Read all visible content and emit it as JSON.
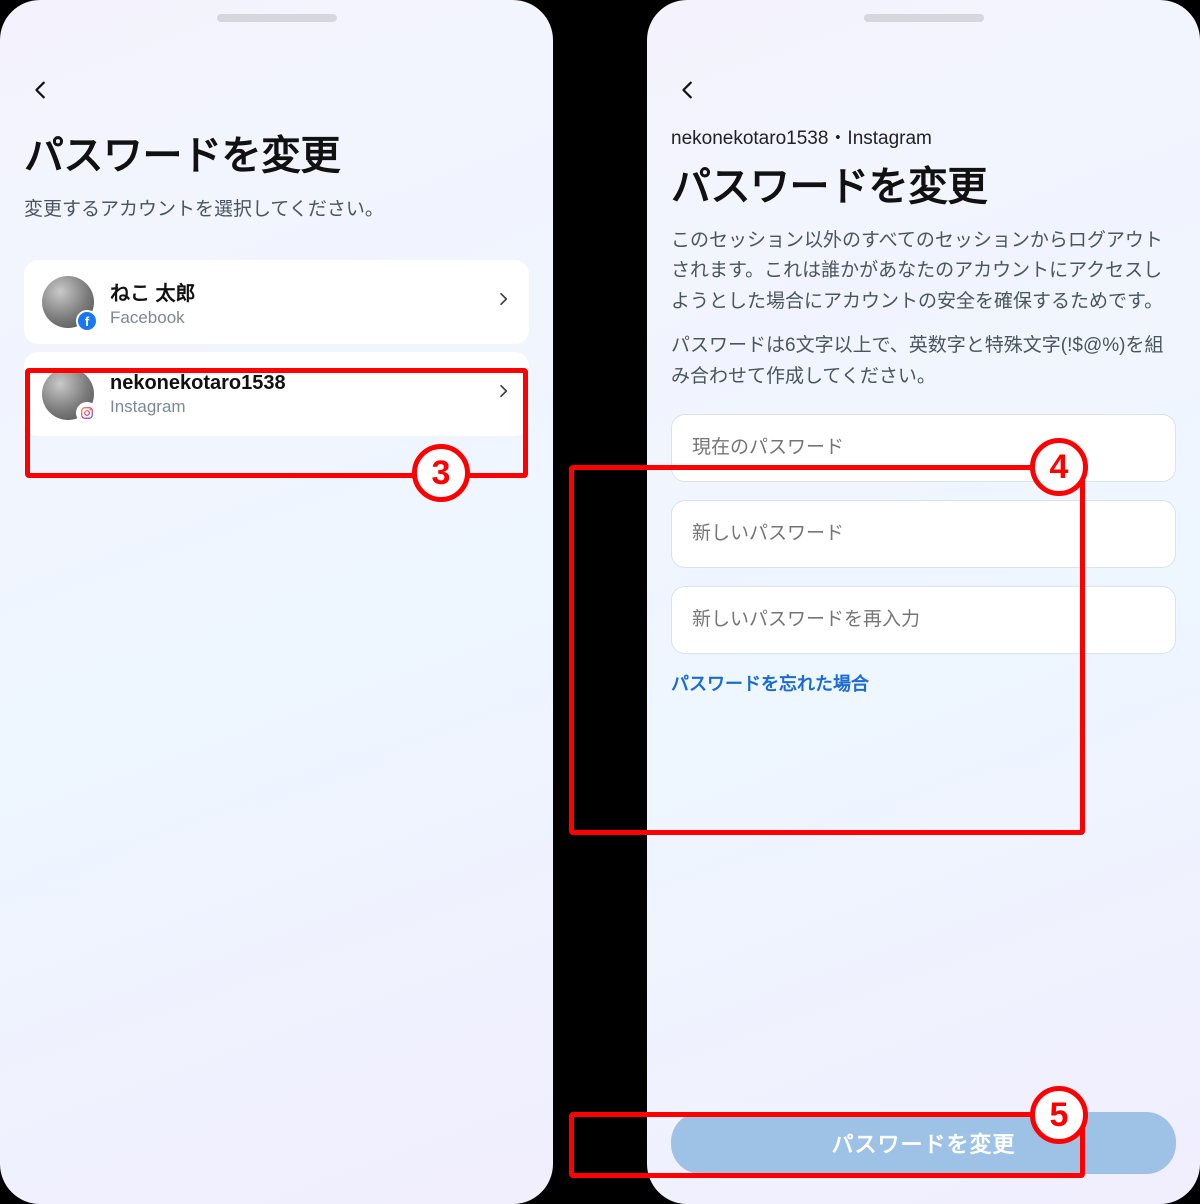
{
  "markers": {
    "m3": "3",
    "m4": "4",
    "m5": "5"
  },
  "left": {
    "title": "パスワードを変更",
    "subtitle": "変更するアカウントを選択してください。",
    "accounts": [
      {
        "name": "ねこ 太郎",
        "service": "Facebook",
        "badge": "fb",
        "badge_glyph": "f"
      },
      {
        "name": "nekonekotaro1538",
        "service": "Instagram",
        "badge": "ig",
        "badge_glyph": ""
      }
    ]
  },
  "right": {
    "context": "nekonekotaro1538・Instagram",
    "title": "パスワードを変更",
    "desc1": "このセッション以外のすべてのセッションからログアウトされます。これは誰かがあなたのアカウントにアクセスしようとした場合にアカウントの安全を確保するためです。",
    "desc2": "パスワードは6文字以上で、英数字と特殊文字(!$@%)を組み合わせて作成してください。",
    "fields": {
      "current": "現在のパスワード",
      "new": "新しいパスワード",
      "confirm": "新しいパスワードを再入力"
    },
    "forgot": "パスワードを忘れた場合",
    "cta": "パスワードを変更"
  }
}
